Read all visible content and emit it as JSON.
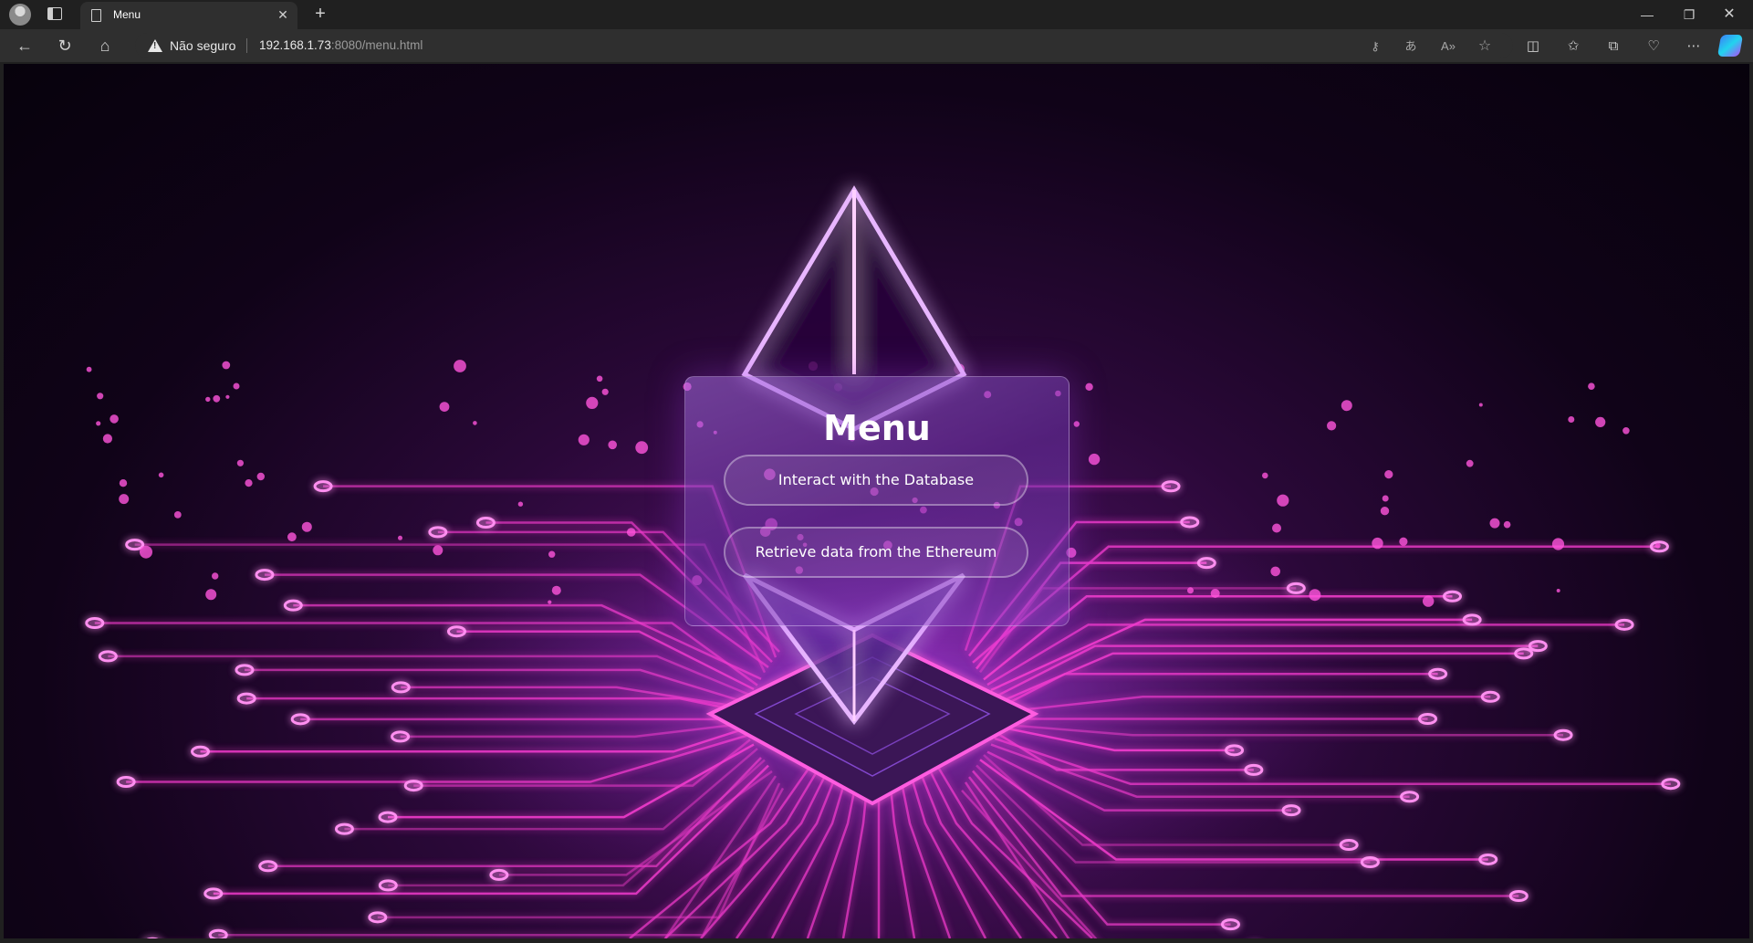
{
  "browser": {
    "tab": {
      "title": "Menu"
    },
    "address_bar": {
      "security_label": "Não seguro",
      "url_host": "192.168.1.73",
      "url_rest": ":8080/menu.html"
    },
    "icons": [
      "profile-icon",
      "tab-actions-icon",
      "page-icon",
      "close-icon",
      "plus-icon",
      "minimize-icon",
      "restore-icon",
      "close-window-icon",
      "back-icon",
      "reload-icon",
      "home-icon",
      "warning-icon",
      "key-icon",
      "translate-icon",
      "read-aloud-icon",
      "favorite-star-icon",
      "split-screen-icon",
      "favorites-icon",
      "collections-icon",
      "browser-essentials-icon",
      "more-icon",
      "copilot-icon"
    ]
  },
  "page": {
    "menu": {
      "title": "Menu",
      "buttons": [
        {
          "label": "Interact with the Database"
        },
        {
          "label": "Retrieve data from the Ethereum"
        }
      ]
    },
    "colors": {
      "accent": "#ff4fd8",
      "glow": "#b46bff",
      "background": "#0c0312"
    }
  }
}
